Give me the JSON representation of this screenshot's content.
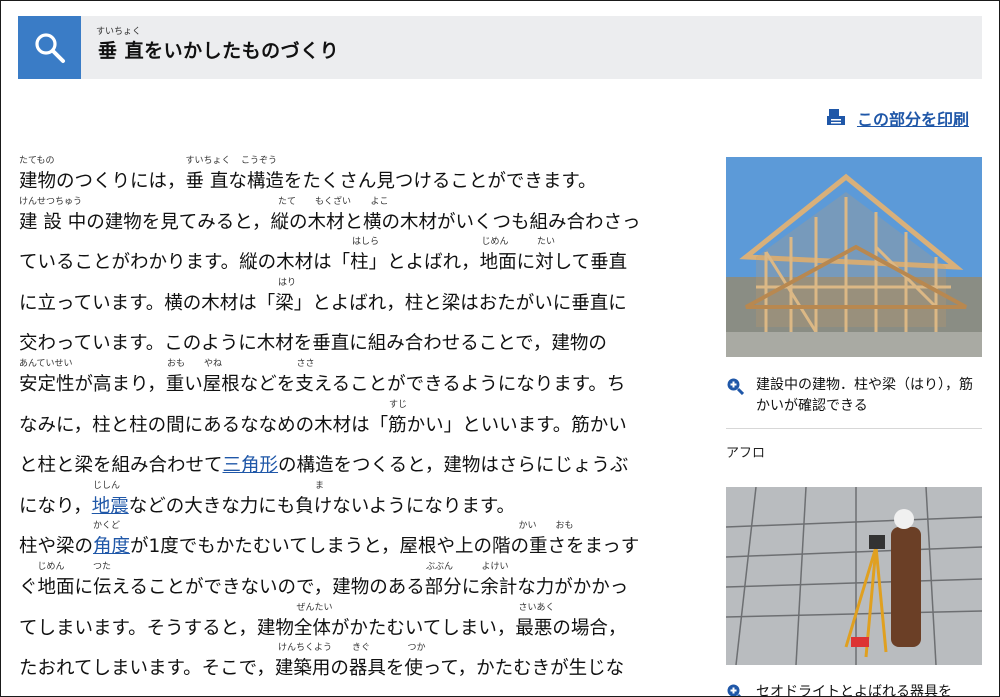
{
  "header": {
    "title": "垂 直をいかしたものづくり",
    "title_ruby": "すいちょく"
  },
  "print": {
    "label": "この部分を印刷"
  },
  "article": {
    "lines": [
      {
        "text": "建物のつくりには，垂 直な構造をたくさん見つけることができます。",
        "ruby": [
          {
            "t": "たてもの",
            "i": 0
          },
          {
            "t": "すいちょく",
            "i": 9
          },
          {
            "t": "こうぞう",
            "i": 12
          }
        ]
      },
      {
        "text": "建 設 中の建物を見てみると，縦の木材と横の木材がいくつも組み合わさっ",
        "ruby": [
          {
            "t": "けんせつちゅう",
            "i": 0
          },
          {
            "t": "たて",
            "i": 14
          },
          {
            "t": "もくざい",
            "i": 16
          },
          {
            "t": "よこ",
            "i": 19
          }
        ]
      },
      {
        "text": "ていることがわかります。縦の木材は「柱」とよばれ，地面に対して垂直",
        "ruby": [
          {
            "t": "はしら",
            "i": 18
          },
          {
            "t": "じめん",
            "i": 25
          },
          {
            "t": "たい",
            "i": 28
          }
        ]
      },
      {
        "text": "に立っています。横の木材は「梁」とよばれ，柱と梁はおたがいに垂直に",
        "ruby": [
          {
            "t": "はり",
            "i": 14
          }
        ]
      },
      {
        "text": "交わっています。このように木材を垂直に組み合わせることで，建物の",
        "ruby": []
      },
      {
        "text": "安定性が高まり，重い屋根などを支えることができるようになります。ち",
        "ruby": [
          {
            "t": "あんていせい",
            "i": 0
          },
          {
            "t": "おも",
            "i": 8
          },
          {
            "t": "やね",
            "i": 10
          },
          {
            "t": "ささ",
            "i": 15
          }
        ]
      },
      {
        "text": "なみに，柱と柱の間にあるななめの木材は「筋かい」といいます。筋かい",
        "ruby": [
          {
            "t": "すじ",
            "i": 20
          }
        ]
      },
      {
        "text": "と柱と梁を組み合わせて三角形の構造をつくると，建物はさらにじょうぶ",
        "ruby": []
      },
      {
        "text": "になり，地震などの大きな力にも負けないようになります。",
        "ruby": [
          {
            "t": "じしん",
            "i": 4
          },
          {
            "t": "ま",
            "i": 16
          }
        ]
      },
      {
        "text": "柱や梁の角度が1度でもかたむいてしまうと，屋根や上の階の重さをまっす",
        "ruby": [
          {
            "t": "かくど",
            "i": 4
          },
          {
            "t": "かい",
            "i": 27
          },
          {
            "t": "おも",
            "i": 29
          }
        ]
      },
      {
        "text": "ぐ地面に伝えることができないので，建物のある部分に余計な力がかかっ",
        "ruby": [
          {
            "t": "じめん",
            "i": 1
          },
          {
            "t": "つた",
            "i": 4
          },
          {
            "t": "ぶぶん",
            "i": 22
          },
          {
            "t": "よけい",
            "i": 25
          }
        ]
      },
      {
        "text": "てしまいます。そうすると，建物全体がかたむいてしまい，最悪の場合，",
        "ruby": [
          {
            "t": "ぜんたい",
            "i": 15
          },
          {
            "t": "さいあく",
            "i": 27
          }
        ]
      },
      {
        "text": "たおれてしまいます。そこで，建築用の器具を使って，かたむきが生じな",
        "ruby": [
          {
            "t": "けんちくよう",
            "i": 14
          },
          {
            "t": "きぐ",
            "i": 18
          },
          {
            "t": "つか",
            "i": 21
          }
        ]
      }
    ],
    "links": [
      "三角形",
      "地震",
      "角度"
    ]
  },
  "sidebar": {
    "caption1": "建設中の建物．柱や梁（はり），筋かいが確認できる",
    "credit1": "アフロ",
    "caption2": "セオドライトとよばれる器具を"
  },
  "colors": {
    "accent": "#3a7cc6",
    "link": "#1f57a8",
    "header_bg": "#ecedef"
  }
}
